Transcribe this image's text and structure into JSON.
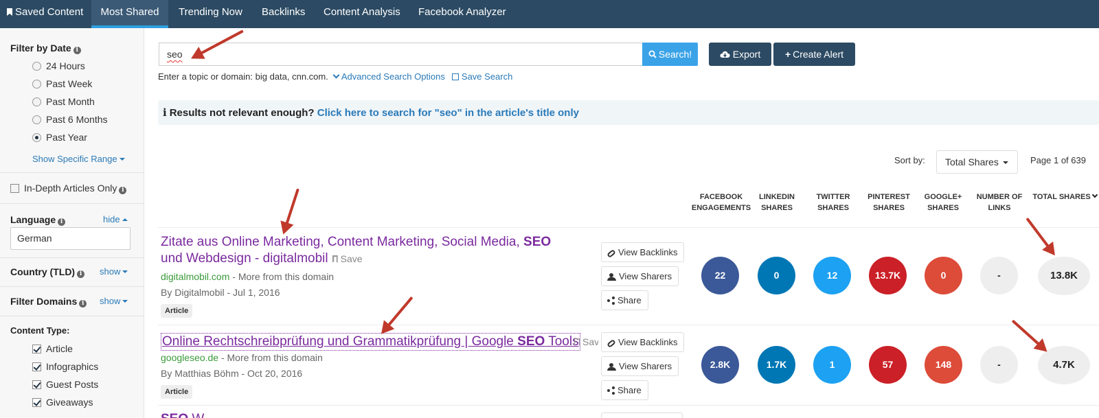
{
  "nav": {
    "items": [
      {
        "label": "Saved Content",
        "active": false
      },
      {
        "label": "Most Shared",
        "active": true
      },
      {
        "label": "Trending Now",
        "active": false
      },
      {
        "label": "Backlinks",
        "active": false
      },
      {
        "label": "Content Analysis",
        "active": false
      },
      {
        "label": "Facebook Analyzer",
        "active": false
      }
    ]
  },
  "sidebar": {
    "filter_date_title": "Filter by Date",
    "date_options": [
      {
        "label": "24 Hours",
        "selected": false
      },
      {
        "label": "Past Week",
        "selected": false
      },
      {
        "label": "Past Month",
        "selected": false
      },
      {
        "label": "Past 6 Months",
        "selected": false
      },
      {
        "label": "Past Year",
        "selected": true
      }
    ],
    "show_specific_range": "Show Specific Range",
    "in_depth_label": "In-Depth Articles Only",
    "language_title": "Language",
    "language_toggle": "hide",
    "language_value": "German",
    "country_title": "Country (TLD)",
    "country_toggle": "show",
    "filter_domains_title": "Filter Domains",
    "filter_domains_toggle": "show",
    "content_type_title": "Content Type:",
    "content_types": [
      {
        "label": "Article",
        "checked": true
      },
      {
        "label": "Infographics",
        "checked": true
      },
      {
        "label": "Guest Posts",
        "checked": true
      },
      {
        "label": "Giveaways",
        "checked": true
      }
    ]
  },
  "search": {
    "value": "seo",
    "button_label": "Search!",
    "hint": "Enter a topic or domain: big data, cnn.com.",
    "advanced_label": "Advanced Search Options",
    "save_label": "Save Search"
  },
  "toolbar": {
    "export_label": "Export",
    "alert_label": "Create Alert"
  },
  "notice": {
    "text": "Results not relevant enough?",
    "link": "Click here to search for \"seo\" in the article's title only"
  },
  "sort": {
    "label": "Sort by:",
    "value": "Total Shares",
    "page": "Page 1 of 639"
  },
  "columns": [
    {
      "line1": "FACEBOOK",
      "line2": "ENGAGEMENTS"
    },
    {
      "line1": "LINKEDIN",
      "line2": "SHARES"
    },
    {
      "line1": "TWITTER",
      "line2": "SHARES"
    },
    {
      "line1": "PINTEREST",
      "line2": "SHARES"
    },
    {
      "line1": "GOOGLE+",
      "line2": "SHARES"
    },
    {
      "line1": "NUMBER OF",
      "line2": "LINKS"
    },
    {
      "line1": "TOTAL SHARES",
      "line2": ""
    }
  ],
  "actions": {
    "backlinks": "View Backlinks",
    "sharers": "View Sharers",
    "share": "Share",
    "save": "Save",
    "more_domain": "- More from this domain"
  },
  "articles": [
    {
      "title_pre": "Zitate aus Online Marketing, Content Marketing, Social Media, ",
      "title_bold": "SEO",
      "title_post": " und Webdesign - digitalmobil",
      "domain": "digitalmobil.com",
      "byline": "By Digitalmobil - Jul 1, 2016",
      "tag": "Article",
      "metrics": [
        "22",
        "0",
        "12",
        "13.7K",
        "0",
        "-",
        "13.8K"
      ]
    },
    {
      "title_pre": "Online Rechtschreibprüfung und Grammatikprüfung | Google ",
      "title_bold": "SEO",
      "title_post": " Tools",
      "domain": "googleseo.de",
      "byline": "By Matthias Böhm - Oct 20, 2016",
      "tag": "Article",
      "metrics": [
        "2.8K",
        "1.7K",
        "1",
        "57",
        "148",
        "-",
        "4.7K"
      ]
    },
    {
      "title_pre": "",
      "title_bold": "SEO",
      "title_post": " W",
      "partial": true
    }
  ],
  "colors": {
    "nav_bg": "#2c4a63",
    "facebook": "#3b5998",
    "linkedin": "#0077b5",
    "twitter": "#1da1f2",
    "pinterest": "#cb2027",
    "googleplus": "#dd4b39",
    "annotation_arrow": "#c0392b"
  }
}
